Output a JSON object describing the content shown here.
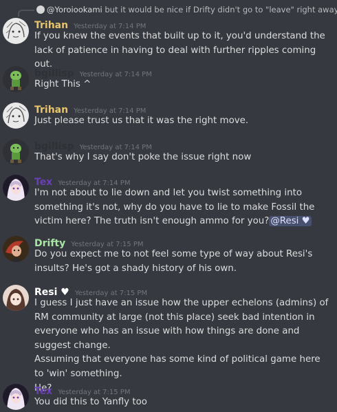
{
  "reply": {
    "mention": "@Yoroiookami",
    "text": " but it would be nice if Drifty didn't go to \"leave\" right away"
  },
  "colors": {
    "background": "#36393f",
    "trihan": "#e8c46c",
    "bgillisp": "#2f3136",
    "tex": "#6a3fb5",
    "drifty": "#a8e6a3",
    "resi": "#ffffff",
    "timestamp": "#72767d"
  },
  "messages": [
    {
      "author": "Trihan",
      "time": "Yesterday at 7:14 PM",
      "avatar_icon": "sketch-face-avatar",
      "lines": [
        "If you knew the events that built up to it, you'd understand the lack of patience in having to deal with further ripples coming out."
      ]
    },
    {
      "author": "bgillisp",
      "time": "Yesterday at 7:14 PM",
      "avatar_icon": "green-goblin-avatar",
      "lines": [
        "Right This ^"
      ]
    },
    {
      "author": "Trihan",
      "time": "Yesterday at 7:14 PM",
      "avatar_icon": "sketch-face-avatar",
      "lines": [
        "Just please trust us that it was the right move."
      ]
    },
    {
      "author": "bgillisp",
      "time": "Yesterday at 7:14 PM",
      "avatar_icon": "green-goblin-avatar",
      "lines": [
        "That's why I say don't poke the issue right now"
      ]
    },
    {
      "author": "Tex",
      "time": "Yesterday at 7:14 PM",
      "avatar_icon": "anime-girl-avatar",
      "lines": [
        "I'm not about to lie down and let you twist something into something it's not, why do you have to lie to make Fossil the victim here? The truth isn't enough ammo for you?"
      ],
      "mention": "@Resi ♥"
    },
    {
      "author": "Drifty",
      "time": "Yesterday at 7:15 PM",
      "avatar_icon": "red-character-avatar",
      "lines": [
        "Do you expect me to not feel some type of way about Resi's insults? He's got a shady history of his own."
      ]
    },
    {
      "author": "Resi ♥",
      "time": "Yesterday at 7:15 PM",
      "avatar_icon": "anime-girl-brown-hair-avatar",
      "lines": [
        "I guess I just have an issue how the upper echelons (admins) of RM community at large (not this place) seek bad intention in everyone who has an issue with how things are done and suggest change.",
        "Assuming that everyone has some kind of political game here to 'win' something.",
        "He?"
      ]
    },
    {
      "author": "Tex",
      "time": "Yesterday at 7:15 PM",
      "avatar_icon": "anime-girl-avatar",
      "lines": [
        "You did this to Yanfly too"
      ]
    }
  ]
}
